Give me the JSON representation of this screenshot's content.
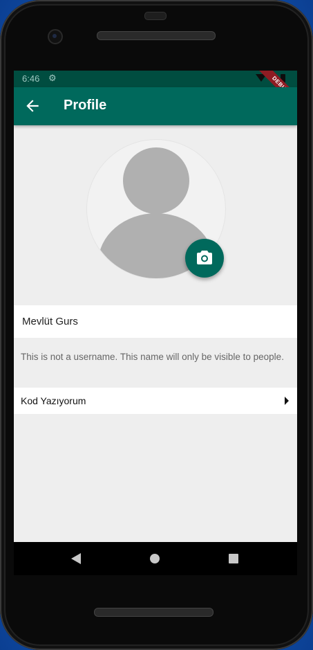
{
  "status_bar": {
    "time": "6:46",
    "settings_icon": "gear-icon",
    "debug_label": "DEBUG"
  },
  "app_bar": {
    "title": "Profile",
    "back_icon": "arrow-back-icon"
  },
  "profile": {
    "avatar_icon": "person-placeholder-icon",
    "camera_icon": "camera-icon",
    "name": "Mevlüt Gurs",
    "name_hint": "This is not a username. This name will only be visible to people.",
    "about": "Kod Yazıyorum",
    "about_icon": "chevron-right-icon"
  },
  "navigation": {
    "back_icon": "nav-back-icon",
    "home_icon": "nav-home-icon",
    "recents_icon": "nav-recents-icon"
  },
  "colors": {
    "primary": "#00695c",
    "status_bar": "#004d40",
    "background": "#eeeeee",
    "debug_banner": "#8e1c23",
    "avatar_silhouette": "#b0b0b0"
  }
}
